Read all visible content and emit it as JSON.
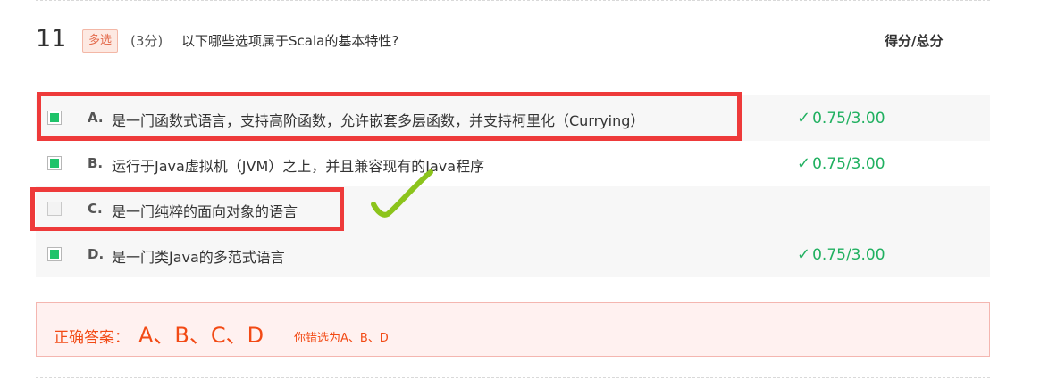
{
  "question": {
    "number": "11",
    "type_badge": "多选",
    "points": "(3分)",
    "text": "以下哪些选项属于Scala的基本特性?",
    "score_header": "得分/总分"
  },
  "options": [
    {
      "letter": "A.",
      "text": "是一门函数式语言，支持高阶函数，允许嵌套多层函数，并支持柯里化（Currying）",
      "checked": true,
      "score": "0.75/3.00"
    },
    {
      "letter": "B.",
      "text": "运行于Java虚拟机（JVM）之上，并且兼容现有的Java程序",
      "checked": true,
      "score": "0.75/3.00"
    },
    {
      "letter": "C.",
      "text": "是一门纯粹的面向对象的语言",
      "checked": false,
      "score": ""
    },
    {
      "letter": "D.",
      "text": "是一门类Java的多范式语言",
      "checked": true,
      "score": "0.75/3.00"
    }
  ],
  "answer": {
    "label": "正确答案：",
    "value": "A、B、C、D",
    "your_choice": "你错选为A、B、D"
  },
  "icons": {
    "correct": "check-icon",
    "annotation": "handwritten-checkmark-icon"
  },
  "colors": {
    "correct_green": "#20b060",
    "checkbox_green": "#1fc36a",
    "answer_orange": "#f24a15",
    "annotation_red": "#ee3a3a",
    "annotation_check": "#8cc41c"
  }
}
